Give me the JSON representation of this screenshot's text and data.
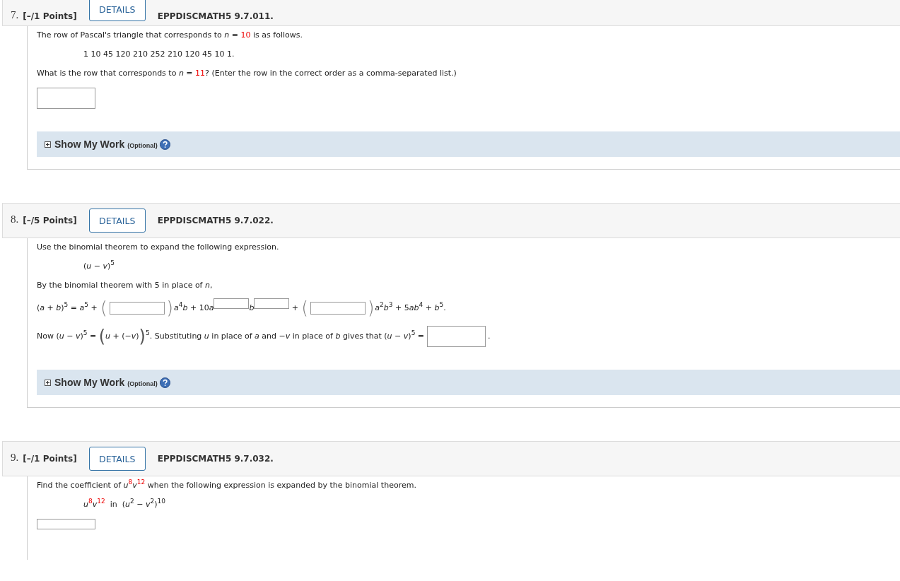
{
  "questions": [
    {
      "number": "7.",
      "points": "[–/1 Points]",
      "details": "DETAILS",
      "code": "EPPDISCMATH5 9.7.011.",
      "lines": [
        {
          "kind": "paragraph",
          "parts": [
            {
              "kind": "text",
              "segments": [
                {
                  "text": "The row of Pascal's triangle that corresponds to *n* = ",
                  "red": false
                },
                {
                  "text": "10",
                  "red": true
                },
                {
                  "text": " is as follows.",
                  "red": false
                }
              ]
            }
          ]
        },
        {
          "kind": "display",
          "parts": [
            {
              "kind": "text",
              "segments": [
                {
                  "text": "1 10 45 120 210 252 210 120 45 10 1.",
                  "red": false
                }
              ]
            }
          ]
        },
        {
          "kind": "paragraph",
          "parts": [
            {
              "kind": "text",
              "segments": [
                {
                  "text": "What is the row that corresponds to *n* = ",
                  "red": false
                },
                {
                  "text": "11",
                  "red": true
                },
                {
                  "text": "? (Enter the row in the correct order as a comma-separated list.)",
                  "red": false
                }
              ]
            }
          ]
        },
        {
          "kind": "paragraph",
          "parts": [
            {
              "kind": "field"
            }
          ]
        }
      ],
      "show_work": {
        "label": "Show My Work",
        "note": "(Optional)"
      }
    },
    {
      "number": "8.",
      "points": "[–/5 Points]",
      "details": "DETAILS",
      "code": "EPPDISCMATH5 9.7.022.",
      "lines": [
        {
          "kind": "paragraph",
          "parts": [
            {
              "kind": "text",
              "segments": [
                {
                  "text": "Use the binomial theorem to expand the following expression.",
                  "red": false
                }
              ]
            }
          ]
        },
        {
          "kind": "display",
          "parts": [
            {
              "kind": "text",
              "segments": [
                {
                  "text": "(*u* − *v*)$^{5}$",
                  "red": false
                }
              ]
            }
          ]
        },
        {
          "kind": "paragraph",
          "parts": [
            {
              "kind": "text",
              "segments": [
                {
                  "text": "By the binomial theorem with 5 in place of *n*,",
                  "red": false
                }
              ]
            }
          ]
        },
        {
          "kind": "paragraph",
          "parts": [
            {
              "kind": "text",
              "segments": [
                {
                  "text": "(*a* + *b*)$^{5}$ = *a*$^{5}$ + ",
                  "red": false
                }
              ]
            },
            {
              "kind": "paren-field",
              "open": "(",
              "close": ")"
            },
            {
              "kind": "text",
              "segments": [
                {
                  "text": "*a*$^{4}$*b* + 10",
                  "red": false
                },
                {
                  "text": "*a*",
                  "red": false
                }
              ]
            },
            {
              "kind": "raised-field"
            },
            {
              "kind": "text",
              "segments": [
                {
                  "text": "*b*",
                  "red": false
                }
              ]
            },
            {
              "kind": "raised-field"
            },
            {
              "kind": "text",
              "segments": [
                {
                  "text": " + ",
                  "red": false
                }
              ]
            },
            {
              "kind": "paren-field",
              "open": "(",
              "close": ")"
            },
            {
              "kind": "text",
              "segments": [
                {
                  "text": "*a*$^{2}$*b*$^{3}$ + 5",
                  "red": false
                },
                {
                  "text": "*ab*$^{4}$ + *b*$^{5}$.",
                  "red": false
                }
              ]
            }
          ]
        },
        {
          "kind": "paragraph",
          "parts": [
            {
              "kind": "text",
              "segments": [
                {
                  "text": "Now (*u* − *v*)$^{5}$ = ",
                  "red": false
                }
              ]
            },
            {
              "kind": "big-text",
              "text": "("
            },
            {
              "kind": "text",
              "segments": [
                {
                  "text": "*u* + (−*v*)",
                  "red": false
                }
              ]
            },
            {
              "kind": "big-text",
              "text": ")"
            },
            {
              "kind": "text",
              "segments": [
                {
                  "text": "$^{5}$. Substituting *u* in place of *a* and −*v* in place of *b* gives that (*u* − *v*)$^{5}$ = ",
                  "red": false
                }
              ]
            },
            {
              "kind": "field"
            },
            {
              "kind": "text",
              "segments": [
                {
                  "text": " .",
                  "red": false
                }
              ]
            }
          ]
        }
      ],
      "show_work": {
        "label": "Show My Work",
        "note": "(Optional)"
      }
    },
    {
      "number": "9.",
      "points": "[–/1 Points]",
      "details": "DETAILS",
      "code": "EPPDISCMATH5 9.7.032.",
      "lines": [
        {
          "kind": "paragraph",
          "parts": [
            {
              "kind": "text",
              "segments": [
                {
                  "text": "Find the coefficient of *u*",
                  "red": false
                },
                {
                  "text": "$^{8}$",
                  "red": true
                },
                {
                  "text": "*v*",
                  "red": false
                },
                {
                  "text": "$^{12}$",
                  "red": true
                },
                {
                  "text": " when the following expression is expanded by the binomial theorem.",
                  "red": false
                }
              ]
            }
          ]
        },
        {
          "kind": "display",
          "parts": [
            {
              "kind": "text",
              "segments": [
                {
                  "text": "*u*",
                  "red": false
                },
                {
                  "text": "$^{8}$",
                  "red": true
                },
                {
                  "text": "*v*",
                  "red": false
                },
                {
                  "text": "$^{12}$",
                  "red": true
                },
                {
                  "text": "  in  (*u*$^{2}$ − *v*$^{2}$)$^{10}$",
                  "red": false
                }
              ]
            }
          ]
        },
        {
          "kind": "paragraph",
          "parts": [
            {
              "kind": "thin-field"
            }
          ]
        }
      ]
    }
  ]
}
